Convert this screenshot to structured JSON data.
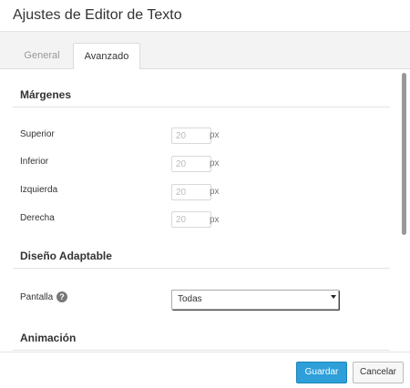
{
  "dialog": {
    "title": "Ajustes de Editor de Texto"
  },
  "tabs": [
    {
      "label": "General",
      "active": false
    },
    {
      "label": "Avanzado",
      "active": true
    }
  ],
  "sections": {
    "margins": {
      "title": "Márgenes",
      "fields": [
        {
          "label": "Superior",
          "value": "20",
          "unit": "px"
        },
        {
          "label": "Inferior",
          "value": "20",
          "unit": "px"
        },
        {
          "label": "Izquierda",
          "value": "20",
          "unit": "px"
        },
        {
          "label": "Derecha",
          "value": "20",
          "unit": "px"
        }
      ]
    },
    "responsive": {
      "title": "Diseño Adaptable",
      "screen_label": "Pantalla",
      "help_icon": "?",
      "screen_value": "Todas"
    },
    "animation": {
      "title": "Animación"
    }
  },
  "footer": {
    "save_label": "Guardar",
    "cancel_label": "Cancelar"
  },
  "colors": {
    "accent": "#2e9fd9"
  }
}
